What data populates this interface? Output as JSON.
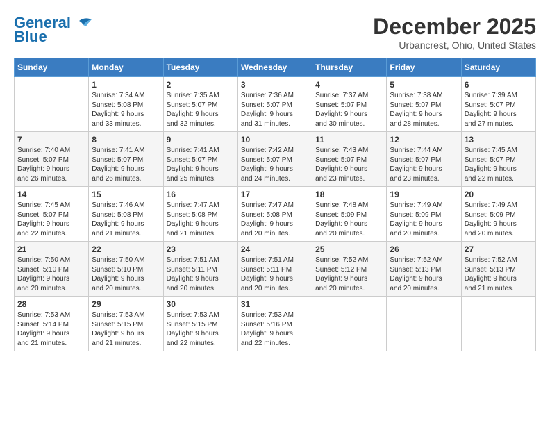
{
  "header": {
    "logo_line1": "General",
    "logo_line2": "Blue",
    "month": "December 2025",
    "location": "Urbancrest, Ohio, United States"
  },
  "weekdays": [
    "Sunday",
    "Monday",
    "Tuesday",
    "Wednesday",
    "Thursday",
    "Friday",
    "Saturday"
  ],
  "weeks": [
    [
      {
        "day": "",
        "info": ""
      },
      {
        "day": "1",
        "info": "Sunrise: 7:34 AM\nSunset: 5:08 PM\nDaylight: 9 hours\nand 33 minutes."
      },
      {
        "day": "2",
        "info": "Sunrise: 7:35 AM\nSunset: 5:07 PM\nDaylight: 9 hours\nand 32 minutes."
      },
      {
        "day": "3",
        "info": "Sunrise: 7:36 AM\nSunset: 5:07 PM\nDaylight: 9 hours\nand 31 minutes."
      },
      {
        "day": "4",
        "info": "Sunrise: 7:37 AM\nSunset: 5:07 PM\nDaylight: 9 hours\nand 30 minutes."
      },
      {
        "day": "5",
        "info": "Sunrise: 7:38 AM\nSunset: 5:07 PM\nDaylight: 9 hours\nand 28 minutes."
      },
      {
        "day": "6",
        "info": "Sunrise: 7:39 AM\nSunset: 5:07 PM\nDaylight: 9 hours\nand 27 minutes."
      }
    ],
    [
      {
        "day": "7",
        "info": "Sunrise: 7:40 AM\nSunset: 5:07 PM\nDaylight: 9 hours\nand 26 minutes."
      },
      {
        "day": "8",
        "info": "Sunrise: 7:41 AM\nSunset: 5:07 PM\nDaylight: 9 hours\nand 26 minutes."
      },
      {
        "day": "9",
        "info": "Sunrise: 7:41 AM\nSunset: 5:07 PM\nDaylight: 9 hours\nand 25 minutes."
      },
      {
        "day": "10",
        "info": "Sunrise: 7:42 AM\nSunset: 5:07 PM\nDaylight: 9 hours\nand 24 minutes."
      },
      {
        "day": "11",
        "info": "Sunrise: 7:43 AM\nSunset: 5:07 PM\nDaylight: 9 hours\nand 23 minutes."
      },
      {
        "day": "12",
        "info": "Sunrise: 7:44 AM\nSunset: 5:07 PM\nDaylight: 9 hours\nand 23 minutes."
      },
      {
        "day": "13",
        "info": "Sunrise: 7:45 AM\nSunset: 5:07 PM\nDaylight: 9 hours\nand 22 minutes."
      }
    ],
    [
      {
        "day": "14",
        "info": "Sunrise: 7:45 AM\nSunset: 5:07 PM\nDaylight: 9 hours\nand 22 minutes."
      },
      {
        "day": "15",
        "info": "Sunrise: 7:46 AM\nSunset: 5:08 PM\nDaylight: 9 hours\nand 21 minutes."
      },
      {
        "day": "16",
        "info": "Sunrise: 7:47 AM\nSunset: 5:08 PM\nDaylight: 9 hours\nand 21 minutes."
      },
      {
        "day": "17",
        "info": "Sunrise: 7:47 AM\nSunset: 5:08 PM\nDaylight: 9 hours\nand 20 minutes."
      },
      {
        "day": "18",
        "info": "Sunrise: 7:48 AM\nSunset: 5:09 PM\nDaylight: 9 hours\nand 20 minutes."
      },
      {
        "day": "19",
        "info": "Sunrise: 7:49 AM\nSunset: 5:09 PM\nDaylight: 9 hours\nand 20 minutes."
      },
      {
        "day": "20",
        "info": "Sunrise: 7:49 AM\nSunset: 5:09 PM\nDaylight: 9 hours\nand 20 minutes."
      }
    ],
    [
      {
        "day": "21",
        "info": "Sunrise: 7:50 AM\nSunset: 5:10 PM\nDaylight: 9 hours\nand 20 minutes."
      },
      {
        "day": "22",
        "info": "Sunrise: 7:50 AM\nSunset: 5:10 PM\nDaylight: 9 hours\nand 20 minutes."
      },
      {
        "day": "23",
        "info": "Sunrise: 7:51 AM\nSunset: 5:11 PM\nDaylight: 9 hours\nand 20 minutes."
      },
      {
        "day": "24",
        "info": "Sunrise: 7:51 AM\nSunset: 5:11 PM\nDaylight: 9 hours\nand 20 minutes."
      },
      {
        "day": "25",
        "info": "Sunrise: 7:52 AM\nSunset: 5:12 PM\nDaylight: 9 hours\nand 20 minutes."
      },
      {
        "day": "26",
        "info": "Sunrise: 7:52 AM\nSunset: 5:13 PM\nDaylight: 9 hours\nand 20 minutes."
      },
      {
        "day": "27",
        "info": "Sunrise: 7:52 AM\nSunset: 5:13 PM\nDaylight: 9 hours\nand 21 minutes."
      }
    ],
    [
      {
        "day": "28",
        "info": "Sunrise: 7:53 AM\nSunset: 5:14 PM\nDaylight: 9 hours\nand 21 minutes."
      },
      {
        "day": "29",
        "info": "Sunrise: 7:53 AM\nSunset: 5:15 PM\nDaylight: 9 hours\nand 21 minutes."
      },
      {
        "day": "30",
        "info": "Sunrise: 7:53 AM\nSunset: 5:15 PM\nDaylight: 9 hours\nand 22 minutes."
      },
      {
        "day": "31",
        "info": "Sunrise: 7:53 AM\nSunset: 5:16 PM\nDaylight: 9 hours\nand 22 minutes."
      },
      {
        "day": "",
        "info": ""
      },
      {
        "day": "",
        "info": ""
      },
      {
        "day": "",
        "info": ""
      }
    ]
  ]
}
